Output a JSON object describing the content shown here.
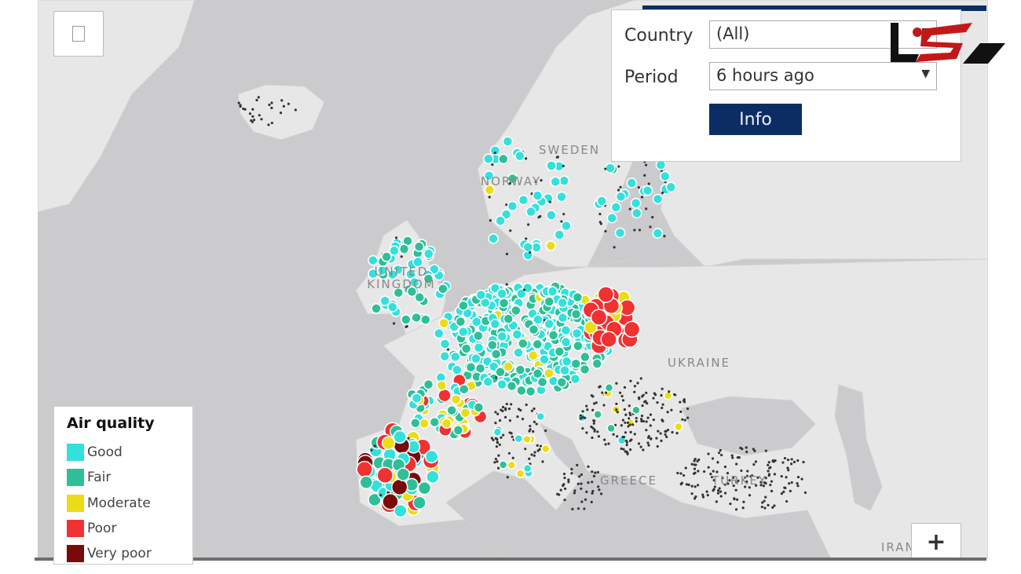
{
  "filters": {
    "country_label": "Country",
    "country_value": "(All)",
    "period_label": "Period",
    "period_value": "6 hours ago",
    "info_button": "Info"
  },
  "legend": {
    "title": "Air quality",
    "items": [
      {
        "label": "Good",
        "color": "#34e0dc"
      },
      {
        "label": "Fair",
        "color": "#2fbf98"
      },
      {
        "label": "Moderate",
        "color": "#ecdc18"
      },
      {
        "label": "Poor",
        "color": "#f03232"
      },
      {
        "label": "Very poor",
        "color": "#7a0a0a"
      }
    ]
  },
  "map_labels": {
    "sweden": "SWEDEN",
    "norway": "NORWAY",
    "uk": "UNITED KINGDOM",
    "ukraine": "UKRAINE",
    "greece": "GREECE",
    "turkey": "TURKEY",
    "iran": "IRAN"
  },
  "controls": {
    "zoom_in": "+",
    "fullscreen_icon": "fullscreen-icon"
  },
  "colors": {
    "sea": "#cbcbcd",
    "land": "#e7e7e7",
    "accent": "#0b2d63",
    "no_data_station": "#333333"
  }
}
